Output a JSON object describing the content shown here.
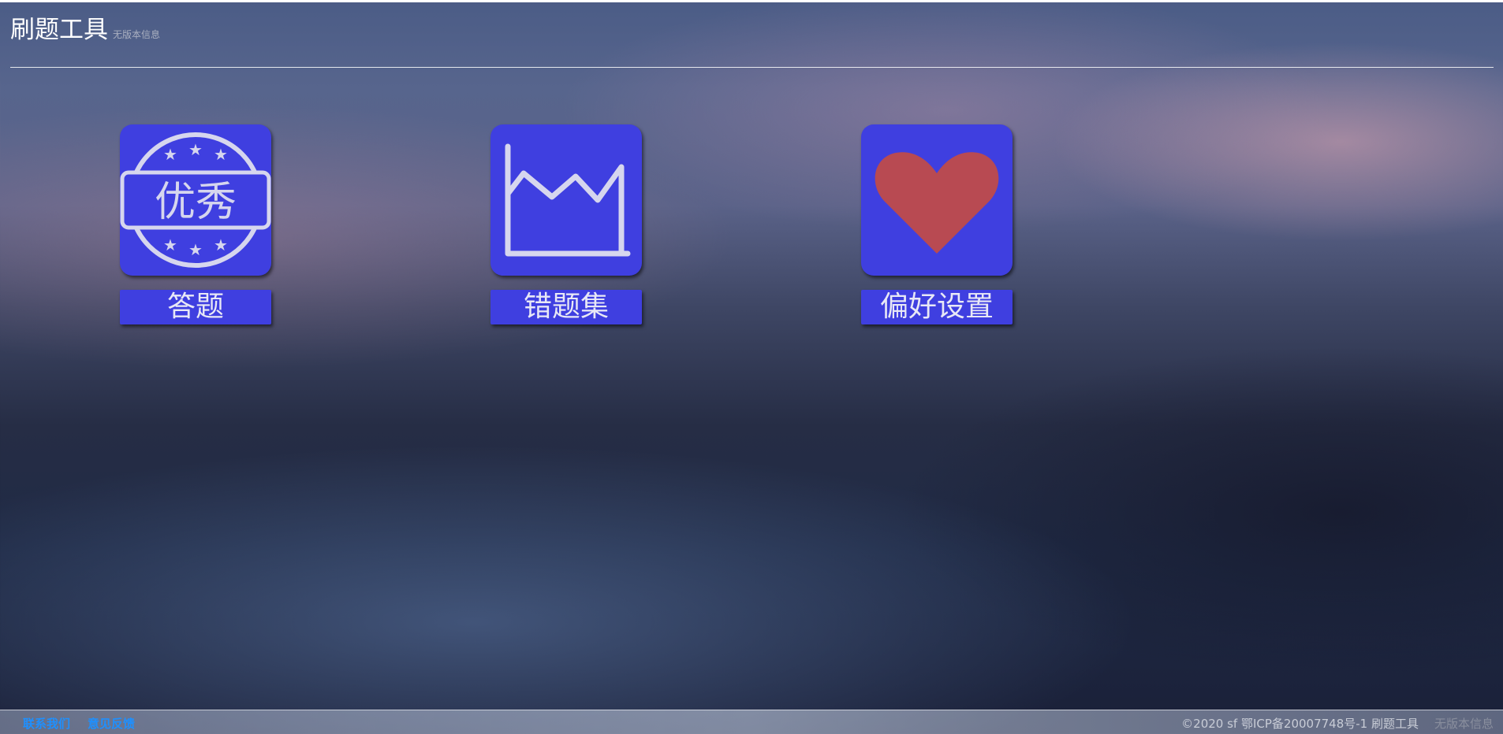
{
  "header": {
    "title": "刷题工具",
    "version": "无版本信息"
  },
  "tiles": [
    {
      "label": "答题",
      "icon": "excellent-badge-icon",
      "badge_text": "优秀"
    },
    {
      "label": "错题集",
      "icon": "area-chart-icon"
    },
    {
      "label": "偏好设置",
      "icon": "heart-icon"
    }
  ],
  "footer": {
    "links": [
      "联系我们",
      "意见反馈"
    ],
    "copyright": "©2020 sf 鄂ICP备20007748号-1 刷题工具",
    "version": "无版本信息"
  },
  "colors": {
    "tile_blue": "#3f3fe0",
    "heart_red": "#b84a52",
    "link_blue": "#1e90ff"
  }
}
